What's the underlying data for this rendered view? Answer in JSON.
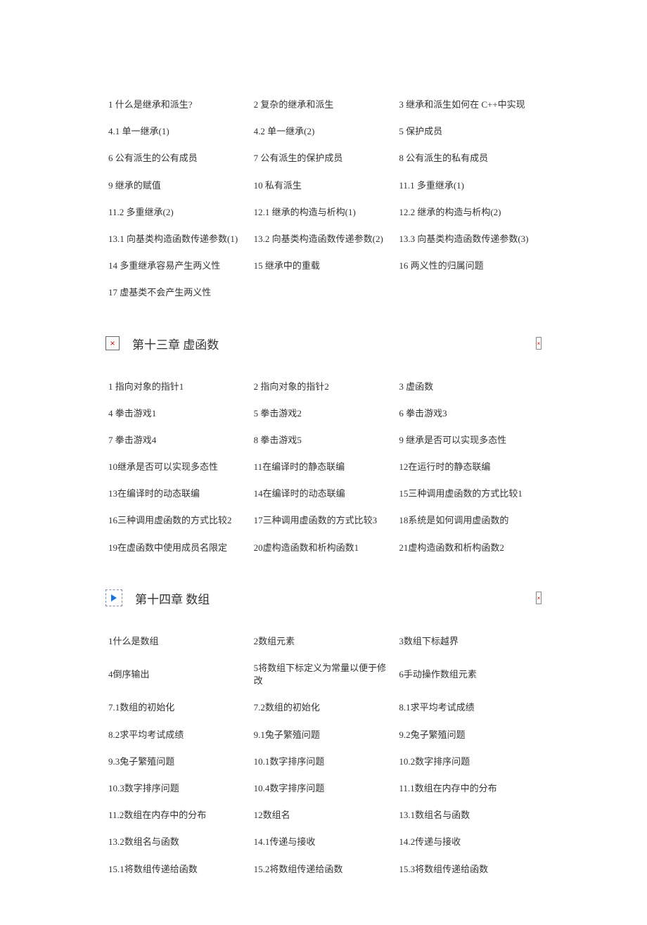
{
  "chapter12": {
    "rows": [
      [
        "1  什么是继承和派生?",
        "2  复杂的继承和派生",
        "3  继承和派生如何在 C++中实现"
      ],
      [
        "4.1  单一继承(1)",
        "4.2  单一继承(2)",
        "5  保护成员"
      ],
      [
        "6  公有派生的公有成员",
        "7  公有派生的保护成员",
        "8  公有派生的私有成员"
      ],
      [
        "9  继承的赋值",
        "10  私有派生",
        "11.1  多重继承(1)"
      ],
      [
        "11.2  多重继承(2)",
        "12.1  继承的构造与析构(1)",
        "12.2  继承的构造与析构(2)"
      ],
      [
        "13.1  向基类构造函数传递参数(1)",
        "13.2  向基类构造函数传递参数(2)",
        "13.3  向基类构造函数传递参数(3)"
      ],
      [
        "14  多重继承容易产生两义性",
        "15  继承中的重载",
        "16  两义性的归属问题"
      ],
      [
        "17  虚基类不会产生两义性",
        "",
        ""
      ]
    ]
  },
  "chapter13": {
    "title": "第十三章  虚函数",
    "rows": [
      [
        "1  指向对象的指针1",
        "2  指向对象的指针2",
        "3  虚函数"
      ],
      [
        "4  拳击游戏1",
        "5  拳击游戏2",
        "6  拳击游戏3"
      ],
      [
        "7  拳击游戏4",
        "8  拳击游戏5",
        "9  继承是否可以实现多态性"
      ],
      [
        "10继承是否可以实现多态性",
        "11在编译时的静态联编",
        "12在运行时的静态联编"
      ],
      [
        "13在编译时的动态联编",
        "14在编译时的动态联编",
        "15三种调用虚函数的方式比较1"
      ],
      [
        "16三种调用虚函数的方式比较2",
        "17三种调用虚函数的方式比较3",
        "18系统是如何调用虚函数的"
      ],
      [
        "19在虚函数中使用成员名限定",
        "20虚构造函数和析构函数1",
        "21虚构造函数和析构函数2"
      ]
    ]
  },
  "chapter14": {
    "title": "第十四章  数组",
    "rows": [
      [
        "1什么是数组",
        "2数组元素",
        "3数组下标越界"
      ],
      [
        "4倒序输出",
        "5将数组下标定义为常量以便于修改",
        "6手动操作数组元素"
      ],
      [
        "7.1数组的初始化",
        "7.2数组的初始化",
        "8.1求平均考试成绩"
      ],
      [
        "8.2求平均考试成绩",
        "9.1兔子繁殖问题",
        "9.2兔子繁殖问题"
      ],
      [
        "9.3兔子繁殖问题",
        "10.1数字排序问题",
        "10.2数字排序问题"
      ],
      [
        "10.3数字排序问题",
        "10.4数字排序问题",
        "11.1数组在内存中的分布"
      ],
      [
        "11.2数组在内存中的分布",
        "12数组名",
        "13.1数组名与函数"
      ],
      [
        "13.2数组名与函数",
        "14.1传递与接收",
        "14.2传递与接收"
      ],
      [
        "15.1将数组传递给函数",
        "15.2将数组传递给函数",
        "15.3将数组传递给函数"
      ]
    ]
  }
}
